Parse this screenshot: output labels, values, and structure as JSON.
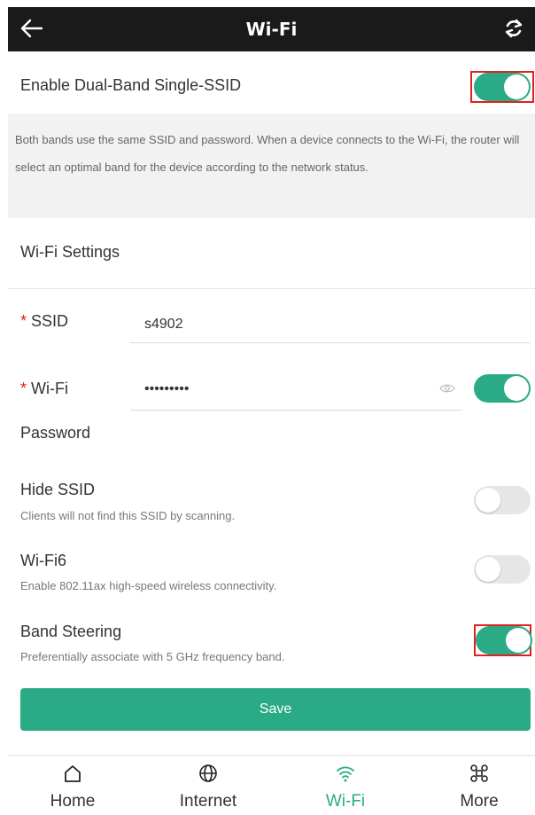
{
  "header": {
    "title": "Wi-Fi",
    "back_icon": "arrow-left-icon",
    "refresh_icon": "refresh-icon"
  },
  "dual_band": {
    "label": "Enable Dual-Band Single-SSID",
    "enabled": true,
    "description": "Both bands use the same SSID and password. When a device connects to the Wi-Fi, the router will select an optimal band for the device according to the network status."
  },
  "wifi_settings": {
    "section_title": "Wi-Fi Settings",
    "ssid": {
      "required_mark": "*",
      "label": "SSID",
      "value": "s4902"
    },
    "password": {
      "required_mark": "*",
      "label_line1": "Wi-Fi",
      "label_line2": "Password",
      "value": "•••••••••",
      "toggle_on": true
    }
  },
  "options": [
    {
      "title": "Hide SSID",
      "description": "Clients will not find this SSID by scanning.",
      "enabled": false
    },
    {
      "title": "Wi-Fi6",
      "description": "Enable 802.11ax high-speed wireless connectivity.",
      "enabled": false
    },
    {
      "title": "Band Steering",
      "description": "Preferentially associate with 5 GHz frequency band.",
      "enabled": true
    }
  ],
  "save_label": "Save",
  "tabs": [
    {
      "label": "Home",
      "icon": "home-icon",
      "active": false
    },
    {
      "label": "Internet",
      "icon": "globe-icon",
      "active": false
    },
    {
      "label": "Wi-Fi",
      "icon": "wifi-icon",
      "active": true
    },
    {
      "label": "More",
      "icon": "command-icon",
      "active": false
    }
  ],
  "colors": {
    "accent": "#2aab86",
    "highlight": "#e02020",
    "header_bg": "#1a1a1a"
  }
}
